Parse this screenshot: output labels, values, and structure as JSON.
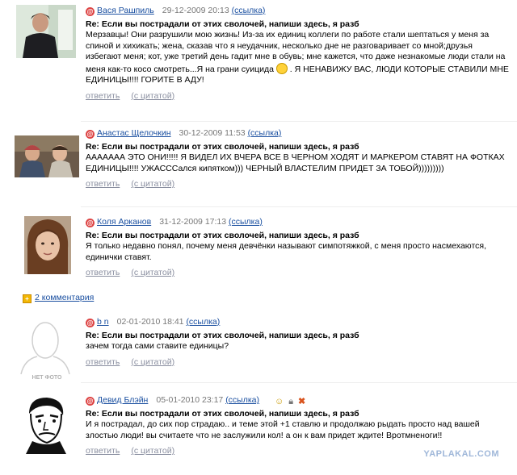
{
  "actions": {
    "reply": "ответить",
    "quote": "(с цитатой)"
  },
  "link_label": "(ссылка)",
  "comments": [
    {
      "user": "Вася Рашпиль",
      "date": "29-12-2009 20:13",
      "subject": "Re: Если вы пострадали от этих сволочей, напиши здесь, я разб",
      "text": "Мерзавцы! Они разрушили мою жизнь! Из-за их единиц коллеги по работе стали шептаться у меня за спиной и хихикать; жена, сказав что я неудачник, несколько дне не разговаривает со мной;друзья избегают меня; кот, уже третий день гадит мне в обувь; мне кажется, что даже незнакомые люди стали на меня как-то косо смотреть...Я на грани суицида",
      "text_after": ". Я НЕНАВИЖУ ВАС, ЛЮДИ КОТОРЫЕ СТАВИЛИ МНЕ ЕДИНИЦЫ!!!! ГОРИТЕ В АДУ!"
    },
    {
      "user": "Анастас Щелочкин",
      "date": "30-12-2009 11:53",
      "subject": "Re: Если вы пострадали от этих сволочей, напиши здесь, я разб",
      "text": "ААААААА ЭТО ОНИ!!!!! Я ВИДЕЛ ИХ ВЧЕРА ВСЕ В ЧЕРНОМ ХОДЯТ И МАРКЕРОМ СТАВЯТ НА ФОТКАХ ЕДИНИЦЫ!!!! УЖАСССался кипятком))) ЧЕРНЫЙ ВЛАСТЕЛИМ ПРИДЕТ ЗА ТОБОЙ)))))))))"
    },
    {
      "user": "Коля Арканов",
      "date": "31-12-2009 17:13",
      "subject": "Re: Если вы пострадали от этих сволочей, напиши здесь, я разб",
      "text": "Я только недавно понял, почему меня девчёнки называют симпотяжкой, с меня просто насмехаются, единички ставят."
    },
    {
      "user": "b n",
      "date": "02-01-2010 18:41",
      "subject": "Re: Если вы пострадали от этих сволочей, напиши здесь, я разб",
      "text": "зачем тогда сами ставите единицы?",
      "avatar_caption": "НЕТ ФОТО"
    },
    {
      "user": "Девид Блэйн",
      "date": "05-01-2010 23:17",
      "subject": "Re: Если вы пострадали от этих сволочей, напиши здесь, я разб",
      "text": "И я пострадал, до сих пор страдаю.. и теме этой +1 ставлю и продолжаю рыдать просто над вашей злостью люди! вы считаете что не заслужили кол! а он к вам придет ждите! Вротмненоги!!"
    }
  ],
  "expand_label": "2 комментария",
  "watermark": "YAPLAKAL.COM"
}
